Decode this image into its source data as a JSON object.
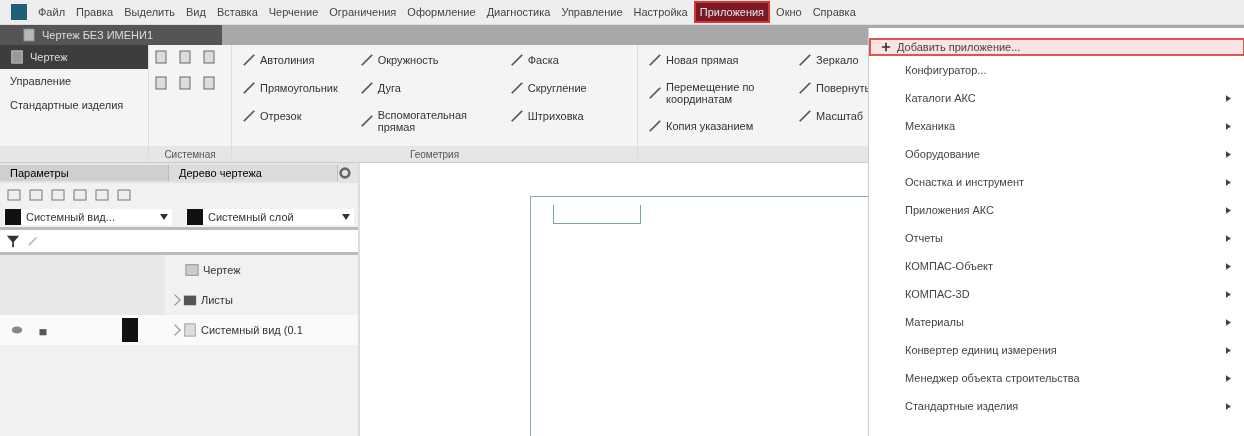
{
  "menu_bar": {
    "items": [
      {
        "label": "Файл",
        "selected": false
      },
      {
        "label": "Правка",
        "selected": false
      },
      {
        "label": "Выделить",
        "selected": false
      },
      {
        "label": "Вид",
        "selected": false
      },
      {
        "label": "Вставка",
        "selected": false
      },
      {
        "label": "Черчение",
        "selected": false
      },
      {
        "label": "Ограничения",
        "selected": false
      },
      {
        "label": "Оформление",
        "selected": false
      },
      {
        "label": "Диагностика",
        "selected": false
      },
      {
        "label": "Управление",
        "selected": false
      },
      {
        "label": "Настройка",
        "selected": false
      },
      {
        "label": "Приложения",
        "selected": true
      },
      {
        "label": "Окно",
        "selected": false
      },
      {
        "label": "Справка",
        "selected": false
      }
    ]
  },
  "document_tab": {
    "title": "Чертеж БЕЗ ИМЕНИ1"
  },
  "ribbon": {
    "mode": "Чертеж",
    "side_commands": [
      "Управление",
      "Стандартные изделия"
    ],
    "groups": [
      {
        "label": "Системная",
        "kind": "icons"
      },
      {
        "label": "Геометрия",
        "columns": [
          [
            "Автолиния",
            "Прямоугольник",
            "Отрезок"
          ],
          [
            "Окружность",
            "Дуга",
            "Вспомогательная прямая"
          ],
          [
            "Фаска",
            "Скругление",
            "Штриховка"
          ]
        ]
      },
      {
        "columns": [
          [
            "Новая прямая",
            "Перемещение по координатам",
            "Копия указанием"
          ],
          [
            "Зеркало",
            "Повернуть",
            "Масштаб"
          ]
        ]
      }
    ]
  },
  "left_panel": {
    "tabs": [
      {
        "label": "Параметры",
        "selected": true
      },
      {
        "label": "Дерево чертежа",
        "selected": false
      }
    ],
    "view_select": "Системный вид...",
    "layer_select": "Системный слой",
    "tree": [
      {
        "label": "Чертеж",
        "kind": "root",
        "children": [
          {
            "label": "Листы",
            "kind": "folder",
            "expanded": false
          },
          {
            "label": "Системный вид (0.1",
            "kind": "view",
            "expanded": false
          }
        ]
      }
    ]
  },
  "applications_menu": {
    "items": [
      {
        "label": "Добавить приложение...",
        "selected": true,
        "submenu": false
      },
      {
        "label": "Конфигуратор...",
        "selected": false,
        "submenu": false
      },
      {
        "label": "Каталоги АКС",
        "selected": false,
        "submenu": true
      },
      {
        "label": "Механика",
        "selected": false,
        "submenu": true
      },
      {
        "label": "Оборудование",
        "selected": false,
        "submenu": true
      },
      {
        "label": "Оснастка и инструмент",
        "selected": false,
        "submenu": true
      },
      {
        "label": "Приложения АКС",
        "selected": false,
        "submenu": true
      },
      {
        "label": "Отчеты",
        "selected": false,
        "submenu": true
      },
      {
        "label": "КОМПАС-Объект",
        "selected": false,
        "submenu": true
      },
      {
        "label": "КОМПАС-3D",
        "selected": false,
        "submenu": true
      },
      {
        "label": "Материалы",
        "selected": false,
        "submenu": true
      },
      {
        "label": "Конвертер единиц измерения",
        "selected": false,
        "submenu": true
      },
      {
        "label": "Менеджер объекта строительства",
        "selected": false,
        "submenu": true
      },
      {
        "label": "Стандартные изделия",
        "selected": false,
        "submenu": true
      }
    ]
  }
}
